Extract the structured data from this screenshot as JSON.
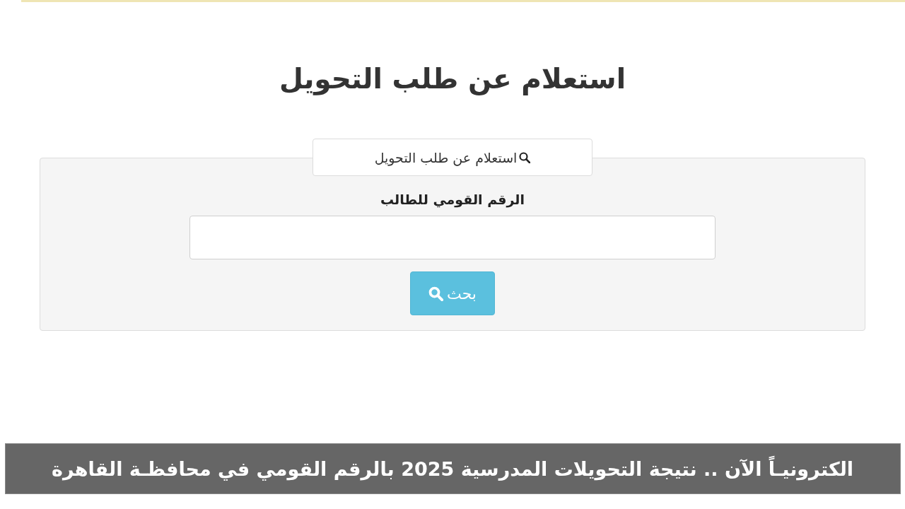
{
  "page": {
    "title": "استعلام عن طلب التحويل"
  },
  "form": {
    "legend": "استعلام عن طلب التحويل",
    "field_label": "الرقم القومي للطالب",
    "search_button": "بحث"
  },
  "caption": "الكترونيـاً الآن .. نتيجة التحويلات المدرسية 2025 بالرقم القومي في محافظـة القاهرة"
}
